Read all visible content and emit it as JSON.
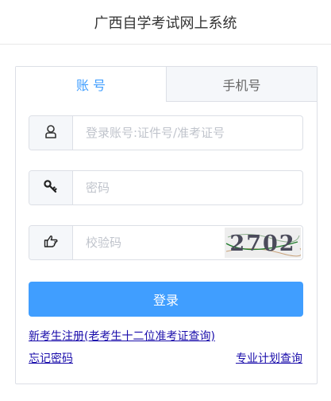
{
  "header": {
    "title": "广西自学考试网上系统"
  },
  "tabs": [
    {
      "label": "账 号",
      "active": true
    },
    {
      "label": "手机号",
      "active": false
    }
  ],
  "form": {
    "account": {
      "placeholder": "登录账号:证件号/准考证号",
      "value": "",
      "icon": "user-icon"
    },
    "password": {
      "placeholder": "密码",
      "value": "",
      "icon": "key-icon"
    },
    "captcha": {
      "placeholder": "校验码",
      "value": "",
      "icon": "hand-pointer-icon",
      "image_text": "2702"
    }
  },
  "login_button": {
    "label": "登录"
  },
  "links": {
    "register": "新考生注册(老考生十二位准考证查询)",
    "forgot_password": "忘记密码",
    "plan_query": "专业计划查询"
  },
  "colors": {
    "accent": "#409eff",
    "link": "#1a0dab",
    "border": "#dcdfe6",
    "tab_inactive_bg": "#f5f7fa"
  }
}
